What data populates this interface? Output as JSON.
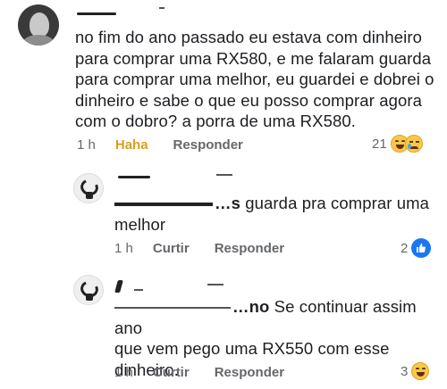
{
  "comments": [
    {
      "text_lines": [
        "no fim do ano passado eu estava com dinheiro",
        "para comprar uma RX580, e me falaram guarda",
        "para comprar uma melhor, eu guardei e dobrei o",
        "dinheiro e sabe o que eu posso comprar agora",
        "com o dobro? a porra de uma RX580."
      ],
      "time": "1 h",
      "reaction_label": "Haha",
      "reply_label": "Responder",
      "reaction_count": "21",
      "reaction_icons": [
        "haha-emoji-icon",
        "sad-emoji-icon"
      ]
    }
  ],
  "replies": [
    {
      "tag_fragment": "…s",
      "text_line1": "guarda pra comprar uma",
      "text_line2": "melhor",
      "time": "1 h",
      "like_label": "Curtir",
      "reply_label": "Responder",
      "reaction_count": "2",
      "reaction_icon": "like-icon"
    },
    {
      "tag_fragment": "…no",
      "text_line1": "Se continuar assim ano",
      "text_line2": "que vem pego uma RX550 com esse",
      "text_line3": "dinheiro.",
      "time": "1 h",
      "like_label": "Curtir",
      "reply_label": "Responder",
      "reaction_count": "3",
      "reaction_icon": "haha-emoji-icon"
    }
  ]
}
